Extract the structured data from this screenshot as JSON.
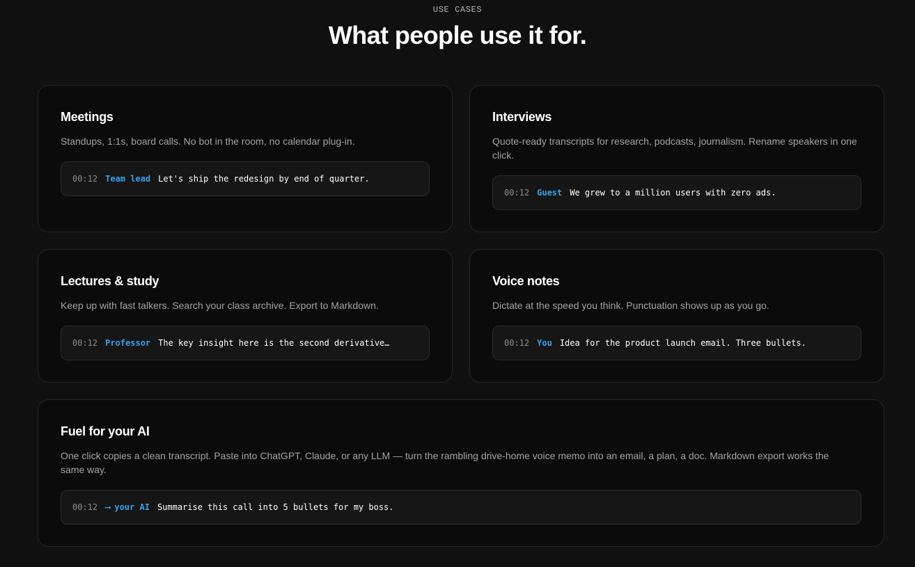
{
  "header": {
    "eyebrow": "USE CASES",
    "title": "What people use it for."
  },
  "accent_color": "#3aa0ea",
  "cards": [
    {
      "title": "Meetings",
      "description": "Standups, 1:1s, board calls. No bot in the room, no calendar plug-in.",
      "snippet": {
        "timestamp": "00:12",
        "speaker": "Team lead",
        "text": "Let's ship the redesign by end of quarter."
      }
    },
    {
      "title": "Interviews",
      "description": "Quote-ready transcripts for research, podcasts, journalism. Rename speakers in one click.",
      "snippet": {
        "timestamp": "00:12",
        "speaker": "Guest",
        "text": "We grew to a million users with zero ads."
      }
    },
    {
      "title": "Lectures & study",
      "description": "Keep up with fast talkers. Search your class archive. Export to Markdown.",
      "snippet": {
        "timestamp": "00:12",
        "speaker": "Professor",
        "text": "The key insight here is the second derivative…"
      }
    },
    {
      "title": "Voice notes",
      "description": "Dictate at the speed you think. Punctuation shows up as you go.",
      "snippet": {
        "timestamp": "00:12",
        "speaker": "You",
        "text": "Idea for the product launch email. Three bullets."
      }
    },
    {
      "title": "Fuel for your AI",
      "description": "One click copies a clean transcript. Paste into ChatGPT, Claude, or any LLM — turn the rambling drive-home voice memo into an email, a plan, a doc. Markdown export works the same way.",
      "snippet": {
        "timestamp": "00:12",
        "arrow": "⟶",
        "speaker": "your AI",
        "text": "Summarise this call into 5 bullets for my boss."
      }
    }
  ]
}
